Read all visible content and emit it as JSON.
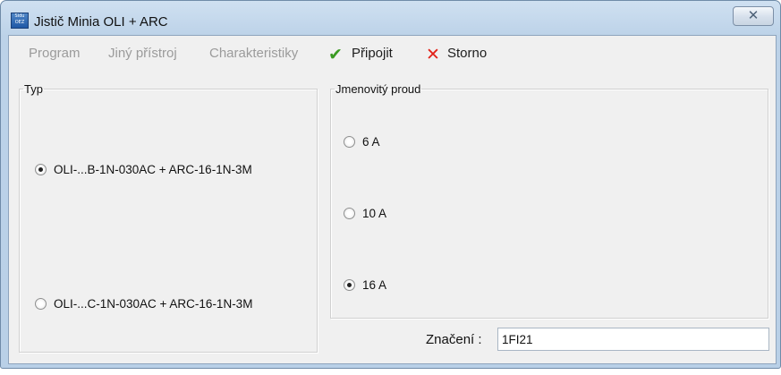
{
  "window": {
    "title": "Jistič Minia OLI + ARC",
    "icon_text": "Sidu OEZ",
    "close_glyph": "✕"
  },
  "menu": {
    "items": [
      {
        "label": "Program",
        "enabled": false
      },
      {
        "label": "Jiný přístroj",
        "enabled": false
      },
      {
        "label": "Charakteristiky",
        "enabled": false
      },
      {
        "label": "Připojit",
        "enabled": true,
        "icon": "check-icon"
      },
      {
        "label": "Storno",
        "enabled": true,
        "icon": "x-icon"
      }
    ]
  },
  "typ": {
    "legend": "Typ",
    "options": [
      {
        "label": "OLI-...B-1N-030AC + ARC-16-1N-3M",
        "checked": true
      },
      {
        "label": "OLI-...C-1N-030AC + ARC-16-1N-3M",
        "checked": false
      }
    ]
  },
  "proud": {
    "legend": "Jmenovitý proud",
    "options": [
      {
        "label": "6 A",
        "checked": false
      },
      {
        "label": "10 A",
        "checked": false
      },
      {
        "label": "16 A",
        "checked": true
      }
    ]
  },
  "znaceni": {
    "label": "Značení :",
    "value": "1FI21"
  },
  "colors": {
    "check": "#3a9a22",
    "cancel": "#e2231a",
    "disabled_text": "#9b9b9b"
  }
}
